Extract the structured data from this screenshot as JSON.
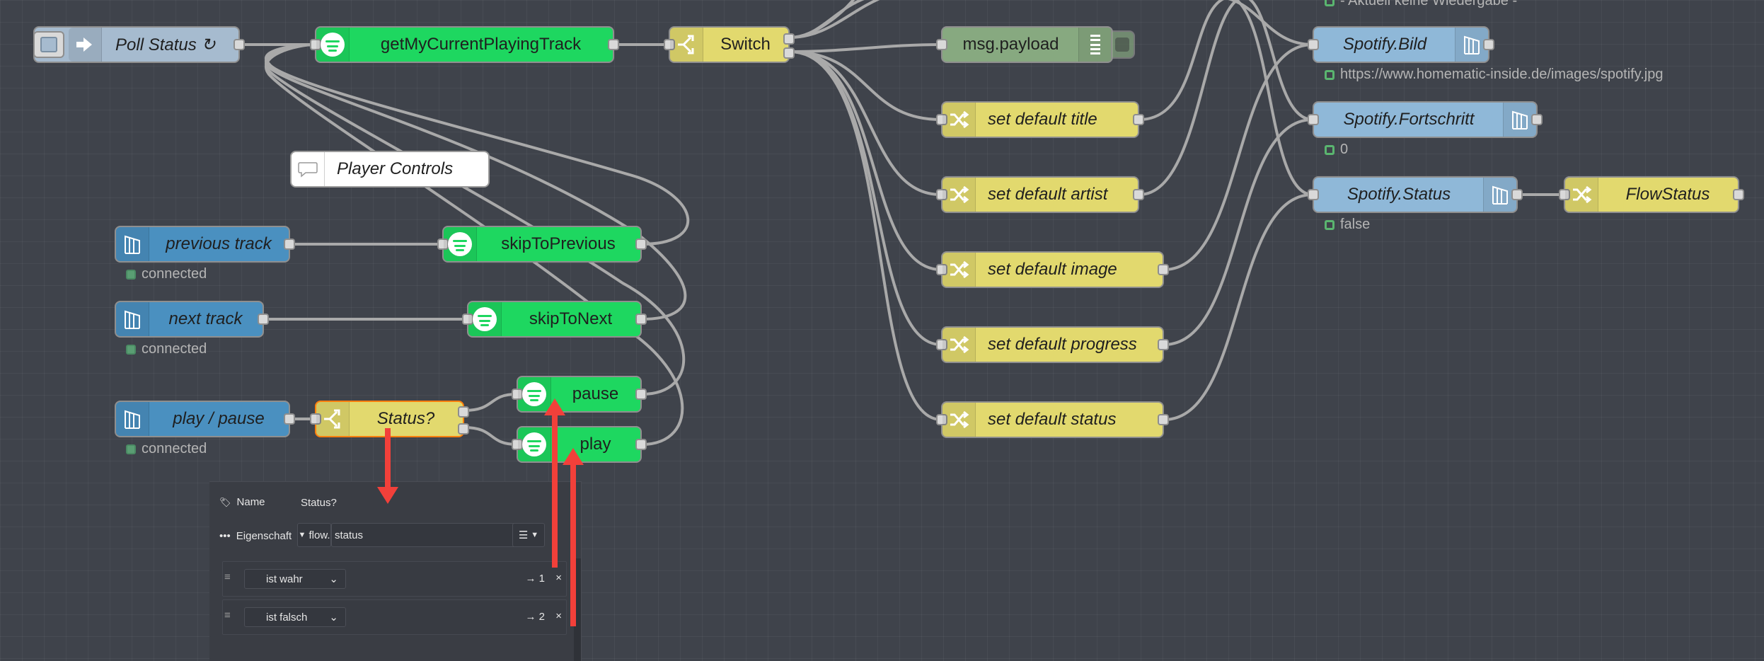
{
  "nodes": {
    "poll_status": "Poll Status ↻",
    "get_track": "getMyCurrentPlayingTrack",
    "switch": "Switch",
    "msg_payload": "msg.payload",
    "set_default_title": "set default title",
    "set_default_artist": "set default artist",
    "set_default_image": "set default image",
    "set_default_progress": "set default progress",
    "set_default_status": "set default status",
    "spotify_bild": "Spotify.Bild",
    "spotify_fortschritt": "Spotify.Fortschritt",
    "spotify_status": "Spotify.Status",
    "flow_status": "FlowStatus",
    "player_controls": "Player Controls",
    "previous_track": "previous track",
    "next_track": "next track",
    "play_pause": "play / pause",
    "skip_previous": "skipToPrevious",
    "skip_next": "skipToNext",
    "status_switch": "Status?",
    "pause": "pause",
    "play": "play"
  },
  "status": {
    "top_partial": "- Aktuell keine Wiedergabe -",
    "bild_url": "https://www.homematic-inside.de/images/spotify.jpg",
    "fortschritt": "0",
    "spotify_status": "false",
    "previous_track": "connected",
    "next_track": "connected",
    "play_pause": "connected"
  },
  "panel": {
    "name_label": "Name",
    "name_value": "Status?",
    "property_label": "Eigenschaft",
    "property_prefix": "flow.",
    "property_value": "status",
    "rules": [
      {
        "operator": "ist wahr",
        "output": "→ 1"
      },
      {
        "operator": "ist falsch",
        "output": "→ 2"
      }
    ]
  },
  "colors": {
    "canvas": "#3f434b",
    "spotify": "#1ed760",
    "function": "#e2d96e",
    "inject": "#a6bbcf",
    "debug": "#87a980",
    "dashboard": "#4a90c0",
    "selected": "#ff7f0e",
    "annotation": "#f2403a"
  }
}
